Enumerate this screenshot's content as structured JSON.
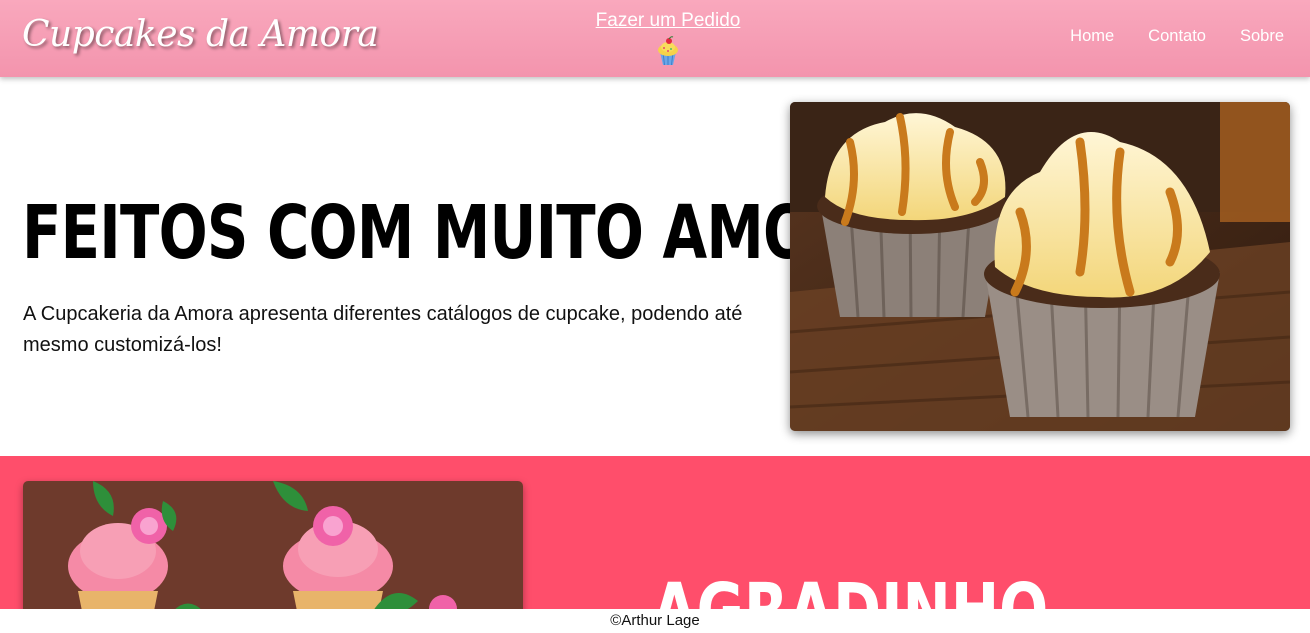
{
  "header": {
    "logo": "Cupcakes da Amora",
    "order_link": "Fazer um Pedido",
    "order_icon": "cupcake-icon",
    "nav": [
      "Home",
      "Contato",
      "Sobre"
    ]
  },
  "hero": {
    "title": "FEITOS COM MUITO AMOR",
    "description": "A Cupcakeria da Amora apresenta diferentes catálogos de cupcake, podendo até mesmo customizá-los!"
  },
  "product": {
    "title": "AGRADINHO"
  },
  "footer": {
    "text": "©Arthur Lage"
  },
  "colors": {
    "header_pink": "#f394ad",
    "section_red": "#ff4e6b",
    "text": "#111111"
  }
}
